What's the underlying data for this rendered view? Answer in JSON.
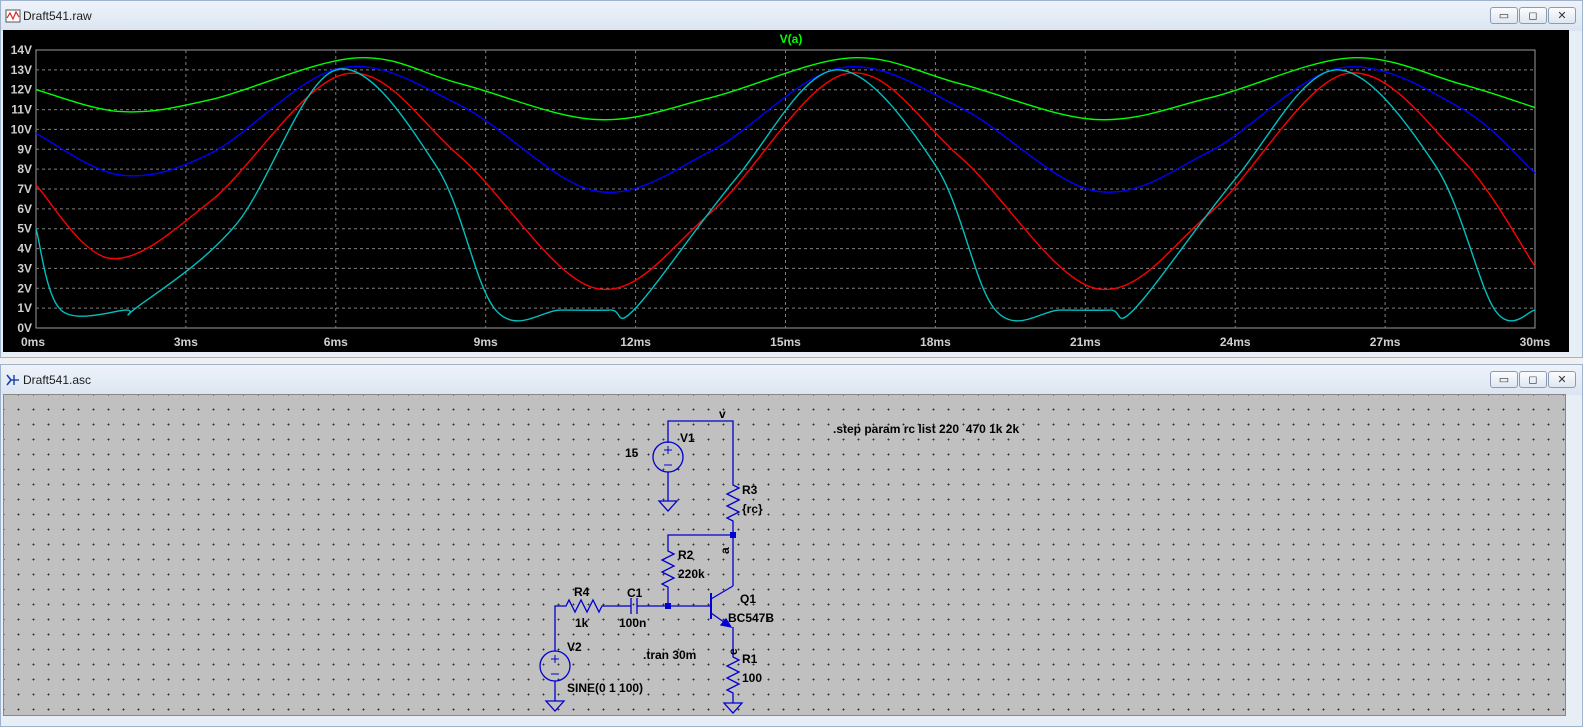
{
  "waveform_window": {
    "title": "Draft541.raw",
    "trace_label": "V(a)",
    "trace_label_color": "#00ff00",
    "icon": "waveform-file-icon"
  },
  "schematic_window": {
    "title": "Draft541.asc",
    "icon": "schematic-file-icon",
    "components": {
      "V1": {
        "name": "V1",
        "value": "15"
      },
      "R3": {
        "name": "R3",
        "value": "{rc}"
      },
      "R2": {
        "name": "R2",
        "value": "220k"
      },
      "R4": {
        "name": "R4",
        "value": "1k"
      },
      "C1": {
        "name": "C1",
        "value": "100n"
      },
      "Q1": {
        "name": "Q1",
        "value": "BC547B"
      },
      "R1": {
        "name": "R1",
        "value": "100"
      },
      "V2": {
        "name": "V2",
        "value": "SINE(0 1 100)"
      }
    },
    "net_labels": {
      "v": "v",
      "a": "a",
      "e": "e"
    },
    "directives": {
      "step": ".step param rc list 220  470 1k 2k",
      "tran": ".tran 30m"
    }
  },
  "window_buttons": {
    "minimize": "▭",
    "restore": "◻",
    "close": "✕"
  },
  "chart_data": {
    "type": "line",
    "title": "V(a)",
    "xlabel": "",
    "ylabel": "",
    "x_ticks": [
      "0ms",
      "3ms",
      "6ms",
      "9ms",
      "12ms",
      "15ms",
      "18ms",
      "21ms",
      "24ms",
      "27ms",
      "30ms"
    ],
    "y_ticks": [
      "0V",
      "1V",
      "2V",
      "3V",
      "4V",
      "5V",
      "6V",
      "7V",
      "8V",
      "9V",
      "10V",
      "11V",
      "12V",
      "13V",
      "14V"
    ],
    "xlim": [
      0,
      30
    ],
    "ylim": [
      0,
      14
    ],
    "grid": true,
    "background": "#000000",
    "series": [
      {
        "color": "#00ff00",
        "x": [
          0,
          1.7,
          3.5,
          6.4,
          8.5,
          11.2,
          13.5,
          16.3,
          18.5,
          21.2,
          23.5,
          26.3,
          28.5,
          30
        ],
        "y": [
          12.0,
          10.9,
          11.5,
          13.6,
          12.3,
          10.5,
          11.6,
          13.6,
          12.3,
          10.5,
          11.6,
          13.6,
          12.3,
          11.1
        ]
      },
      {
        "color": "#0000ff",
        "x": [
          0,
          1.7,
          3.5,
          6.1,
          8.5,
          11.2,
          13.5,
          16.1,
          18.5,
          21.2,
          23.5,
          26.1,
          28.5,
          30
        ],
        "y": [
          9.8,
          7.7,
          8.8,
          13.1,
          11.2,
          6.9,
          8.9,
          13.1,
          11.1,
          6.9,
          8.9,
          13.1,
          11.1,
          7.8
        ]
      },
      {
        "color": "#ff0000",
        "x": [
          0,
          1.5,
          3.5,
          6.2,
          8.5,
          11.2,
          13.5,
          16.2,
          18.5,
          21.2,
          23.5,
          26.2,
          28.5,
          30
        ],
        "y": [
          7.2,
          3.5,
          6.4,
          12.8,
          8.6,
          2.0,
          5.8,
          12.8,
          8.6,
          2.0,
          5.8,
          12.8,
          8.6,
          3.1
        ]
      },
      {
        "color": "#00c0c0",
        "x": [
          0,
          0.5,
          1.8,
          2.0,
          4.0,
          6.0,
          8.0,
          9.2,
          10.5,
          11.5,
          12.0,
          14.0,
          16.0,
          18.0,
          19.2,
          20.5,
          21.5,
          22.0,
          24.0,
          26.0,
          28.0,
          29.2,
          30
        ],
        "y": [
          5.0,
          0.9,
          0.9,
          1.0,
          5.2,
          13.0,
          8.2,
          0.9,
          0.9,
          0.9,
          1.0,
          7.5,
          13.0,
          8.2,
          0.9,
          0.9,
          0.9,
          1.0,
          7.5,
          13.0,
          8.2,
          0.9,
          0.9
        ]
      }
    ]
  }
}
